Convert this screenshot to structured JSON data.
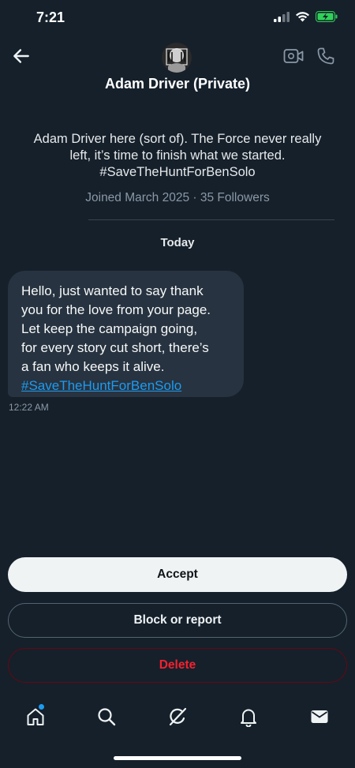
{
  "status_bar": {
    "time": "7:21",
    "battery_color": "#30d158"
  },
  "header": {
    "back_icon": "arrow-left-icon",
    "avatar_icon": "profile-avatar",
    "name": "Adam Driver (Private)",
    "video_icon": "video-call-icon",
    "call_icon": "phone-icon"
  },
  "profile": {
    "bio_lines": [
      "Adam Driver here (sort of). The Force never really",
      "left, it’s time to finish what we started.",
      "#SaveTheHuntForBenSolo"
    ],
    "meta": "Joined March 2025 · 35 Followers"
  },
  "conversation": {
    "date_separator": "Today",
    "message": {
      "lines": [
        "Hello, just wanted to say thank",
        "you for the love from your page.",
        "Let keep the campaign going,",
        "for every story cut short, there’s",
        "a fan who keeps it alive."
      ],
      "hashtag": "#SaveTheHuntForBenSolo",
      "time": "12:22 AM"
    }
  },
  "actions": {
    "accept": "Accept",
    "block_report": "Block or report",
    "delete": "Delete"
  },
  "nav": {
    "items": [
      "home-icon",
      "search-icon",
      "grok-icon",
      "notifications-icon",
      "messages-icon"
    ],
    "accent": "#1d9bf0"
  }
}
